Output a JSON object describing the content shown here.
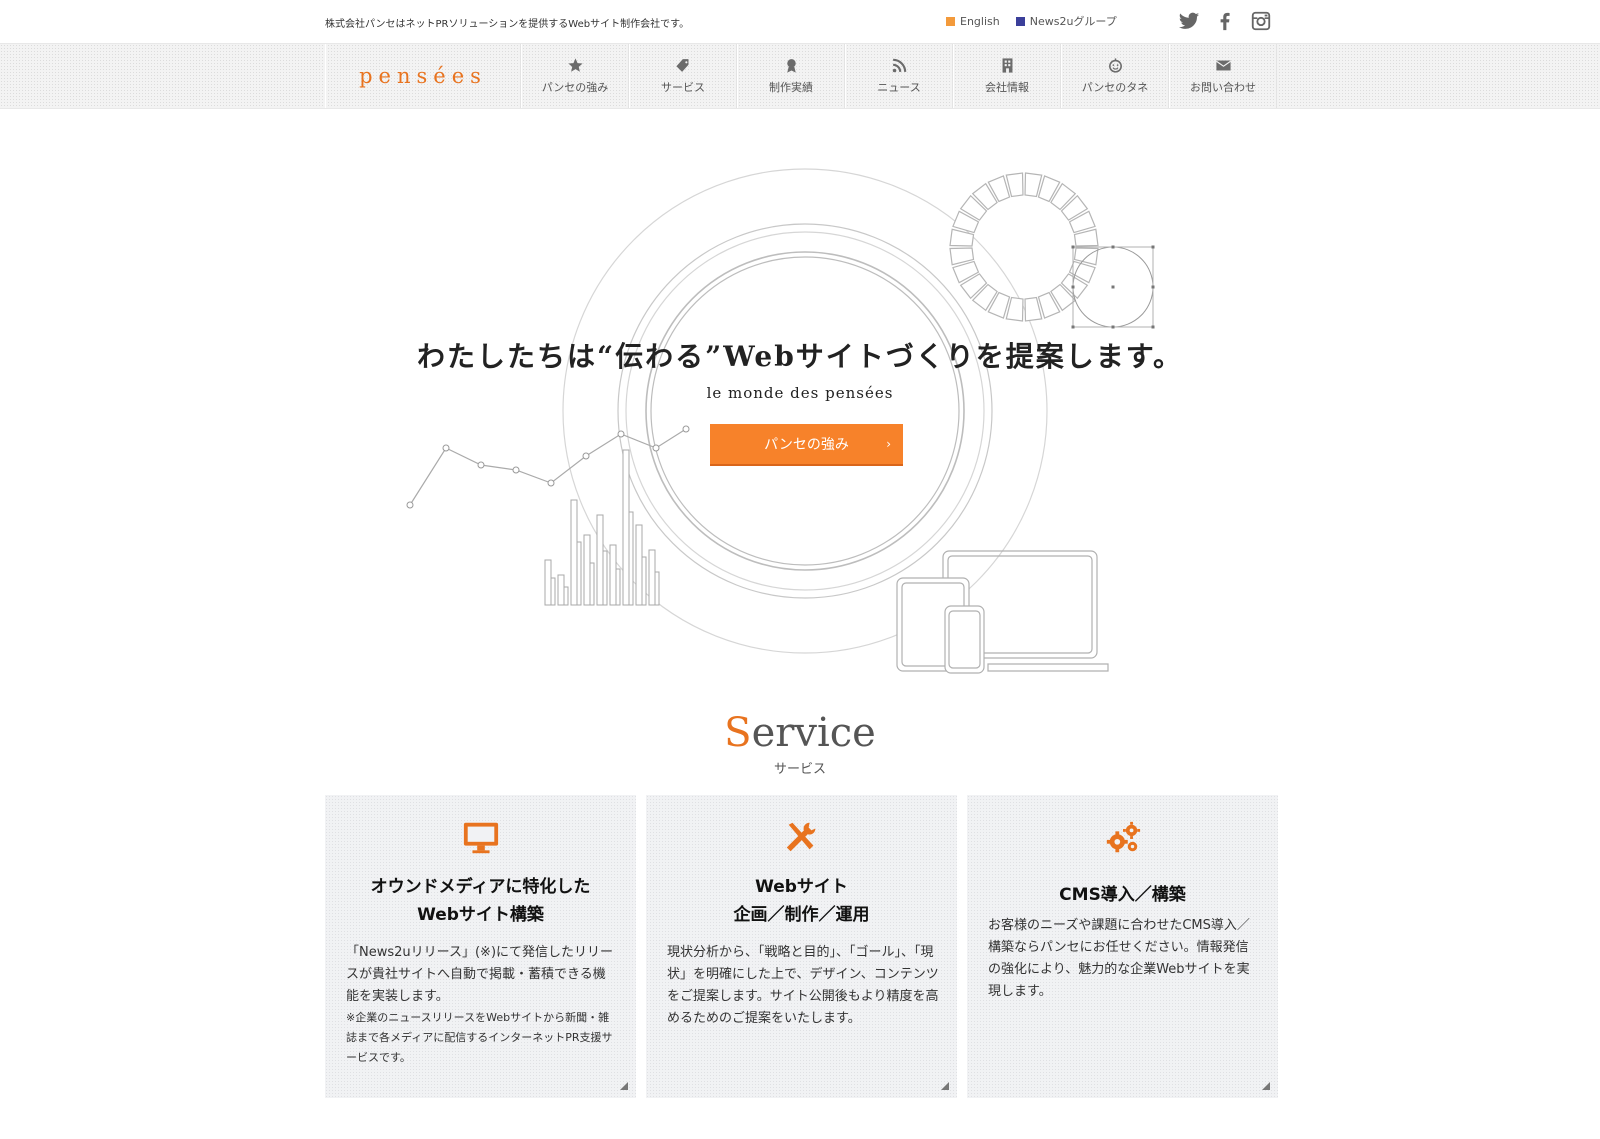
{
  "topbar": {
    "tagline": "株式会社パンセはネットPRソリューションを提供するWebサイト制作会社です。",
    "links": [
      {
        "label": "English",
        "color": "#f39a3b"
      },
      {
        "label": "News2uグループ",
        "color": "#3b3f9a"
      }
    ],
    "social": [
      "twitter-icon",
      "facebook-icon",
      "instagram-icon"
    ]
  },
  "nav": {
    "logo": "pensées",
    "items": [
      {
        "label": "パンセの強み",
        "icon": "star-icon"
      },
      {
        "label": "サービス",
        "icon": "tag-icon"
      },
      {
        "label": "制作実績",
        "icon": "award-icon"
      },
      {
        "label": "ニュース",
        "icon": "rss-icon"
      },
      {
        "label": "会社情報",
        "icon": "building-icon"
      },
      {
        "label": "パンセのタネ",
        "icon": "smile-icon"
      },
      {
        "label": "お問い合わせ",
        "icon": "envelope-icon"
      }
    ]
  },
  "hero": {
    "title": "わたしたちは“伝わる”Webサイトづくりを提案します。",
    "subtitle": "le monde des pensées",
    "button": "パンセの強み",
    "button_chevron": "›"
  },
  "service": {
    "title_initial": "S",
    "title_rest": "ervice",
    "subtitle": "サービス"
  },
  "cards": [
    {
      "icon": "monitor-icon",
      "title_line1": "オウンドメディアに特化した",
      "title_line2": "Webサイト構築",
      "desc": "「News2uリリース」(※)にて発信したリリースが貴社サイトへ自動で掲載・蓄積できる機能を実装します。",
      "note": "※企業のニュースリリースをWebサイトから新聞・雑誌まで各メディアに配信するインターネットPR支援サービスです。"
    },
    {
      "icon": "tools-icon",
      "title_line1": "Webサイト",
      "title_line2": "企画／制作／運用",
      "desc": "現状分析から、「戦略と目的」、「ゴール」、「現状」を明確にした上で、デザイン、コンテンツをご提案します。サイト公開後もより精度を高めるためのご提案をいたします。",
      "note": ""
    },
    {
      "icon": "gears-icon",
      "title_line1": "CMS導入／構築",
      "title_line2": "",
      "desc": "お客様のニーズや課題に合わせたCMS導入／構築ならパンセにお任せください。情報発信の強化により、魅力的な企業Webサイトを実現します。",
      "note": ""
    }
  ],
  "colors": {
    "accent": "#f7822a",
    "brand": "#e8731f"
  }
}
